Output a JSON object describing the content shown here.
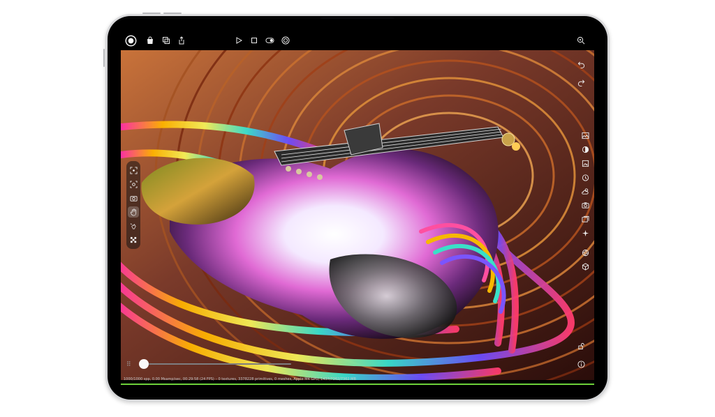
{
  "app": {
    "status_text": "1000/1000 spp, 0.00 Msamp/sec, 00:29:58 (24 FPS) – 0 textures, 3378228 primitives, 0 meshes, Apple M4 GPU, 1437/7362/7362 MB",
    "render_progress": 1.0,
    "timeline_position": 0.03
  },
  "toolbar_left": [
    {
      "name": "record-button-icon",
      "icon": "circle-record"
    },
    {
      "name": "bag-icon",
      "icon": "bag"
    },
    {
      "name": "duplicate-icon",
      "icon": "copy"
    },
    {
      "name": "share-icon",
      "icon": "share"
    }
  ],
  "toolbar_center": [
    {
      "name": "play-icon",
      "icon": "play"
    },
    {
      "name": "stop-icon",
      "icon": "square"
    },
    {
      "name": "toggle-icon",
      "icon": "toggle"
    },
    {
      "name": "target-icon",
      "icon": "target"
    }
  ],
  "toolbar_right": [
    {
      "name": "zoom-icon",
      "icon": "magnifier-plus"
    }
  ],
  "left_tools": [
    {
      "name": "frame-select-icon",
      "active": false
    },
    {
      "name": "focus-icon",
      "active": false
    },
    {
      "name": "camera-icon",
      "active": false
    },
    {
      "name": "hand-icon",
      "active": true
    },
    {
      "name": "pan-icon",
      "active": false
    },
    {
      "name": "checker-icon",
      "active": false
    }
  ],
  "right_tools": [
    "image-icon",
    "exposure-icon",
    "frame-icon",
    "timer-icon",
    "weather-icon",
    "camera-settings-icon",
    "gallery-icon",
    "sparkle-icon",
    "aperture-icon",
    "cube-icon"
  ],
  "top_right_tools": [
    "undo-icon",
    "redo-icon"
  ],
  "bottom_right_tools": [
    "lock-icon",
    "info-icon"
  ],
  "colors": {
    "accent_green": "#6dd13a",
    "bezel": "#050505",
    "frame": "#c6c7ca"
  }
}
